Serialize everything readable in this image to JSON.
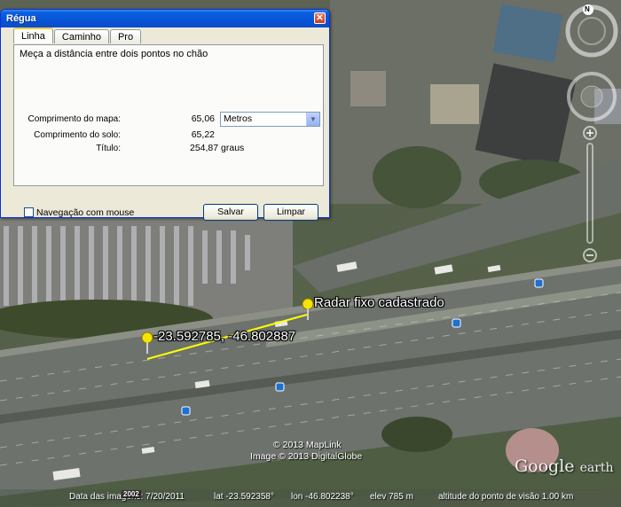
{
  "dialog": {
    "title": "Régua",
    "close_glyph": "✕",
    "tabs": [
      {
        "label": "Linha"
      },
      {
        "label": "Caminho"
      },
      {
        "label": "Pro"
      }
    ],
    "description": "Meça a distância entre dois pontos no chão",
    "map_length_label": "Comprimento do mapa:",
    "map_length_value": "65,06",
    "unit_select": {
      "value": "Metros"
    },
    "ground_length_label": "Comprimento do solo:",
    "ground_length_value": "65,22",
    "heading_label": "Título:",
    "heading_value": "254,87 graus",
    "mouse_nav_label": "Navegação com mouse",
    "save_label": "Salvar",
    "clear_label": "Limpar"
  },
  "map": {
    "pins": [
      {
        "label": "-23.592785, -46.802887"
      },
      {
        "label": "Radar fixo cadastrado"
      }
    ],
    "credits": [
      "© 2013 MapLink",
      "Image © 2013 DigitalGlobe"
    ],
    "logo": {
      "main": "Google",
      "sub": "earth"
    },
    "year_badge": "2002",
    "status": {
      "imagery_date": "Data das imagens: 7/20/2011",
      "lat": "lat  -23.592358°",
      "lon": "lon  -46.802238°",
      "elev": "elev   785 m",
      "eye_alt": "altitude do ponto de visão   1.00 km"
    },
    "compass_letter": "N"
  },
  "colors": {
    "measure_line": "#ffff00",
    "arrow": "#e3001b",
    "titlebar": "#0754d6"
  }
}
